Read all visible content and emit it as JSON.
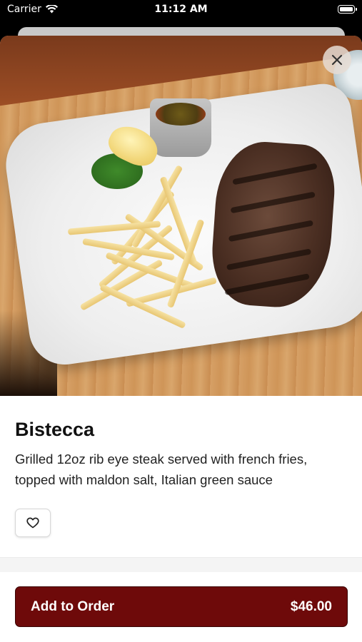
{
  "status_bar": {
    "carrier": "Carrier",
    "time": "11:12 AM",
    "icons": [
      "wifi-icon",
      "battery-icon"
    ]
  },
  "item": {
    "title": "Bistecca",
    "description": "Grilled 12oz rib eye steak served with french fries, topped with maldon salt, Italian green sauce",
    "image_alt": "Grilled rib eye steak with french fries on a white plate"
  },
  "icons": {
    "close": "close-icon",
    "favorite": "heart-icon"
  },
  "order": {
    "label": "Add to Order",
    "price": "$46.00"
  },
  "colors": {
    "accent": "#6e0a0a",
    "background": "#ffffff",
    "text": "#111111"
  }
}
